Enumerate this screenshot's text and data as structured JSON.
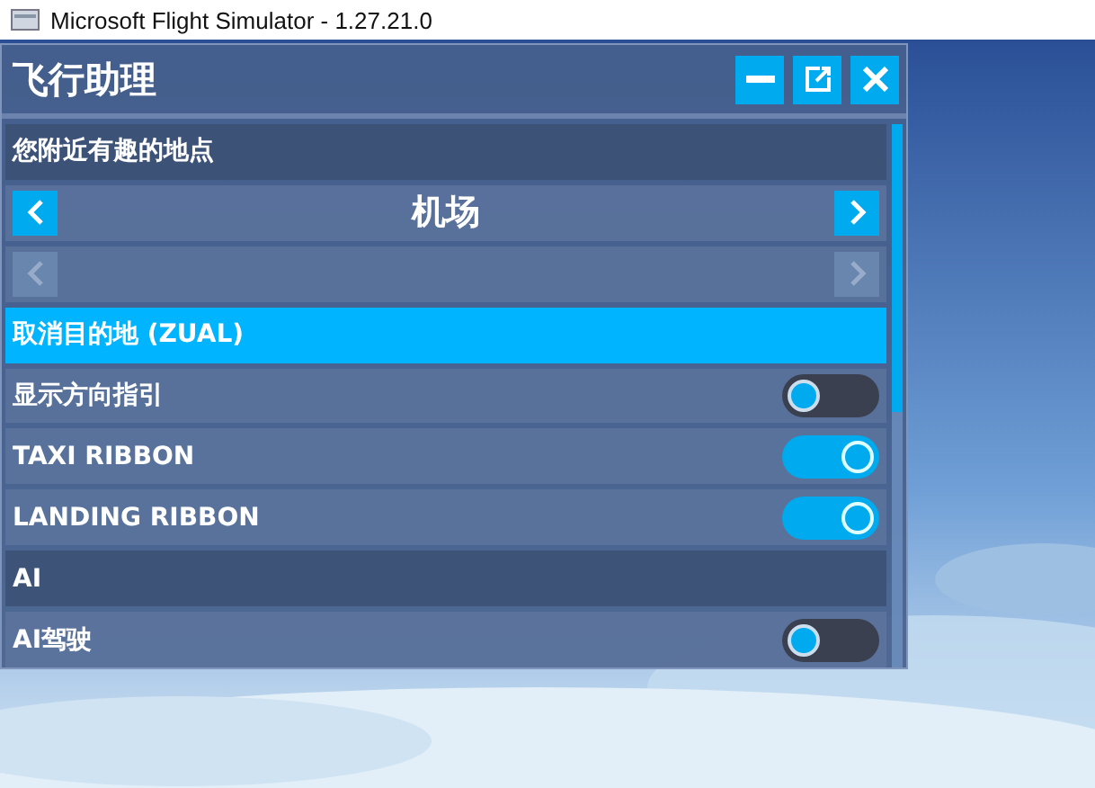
{
  "window": {
    "title": "Microsoft Flight Simulator - 1.27.21.0"
  },
  "panel": {
    "title": "飞行助理",
    "buttons": [
      {
        "kind": "minimize"
      },
      {
        "kind": "popout"
      },
      {
        "kind": "close"
      }
    ],
    "rows": [
      {
        "kind": "header",
        "label": "您附近有趣的地点"
      },
      {
        "kind": "selector",
        "label": "机场",
        "disabled": false
      },
      {
        "kind": "selector",
        "disabled": true
      },
      {
        "kind": "action",
        "label": "取消目的地 (ZUAL)",
        "selected": true
      },
      {
        "kind": "toggle",
        "label": "显示方向指引",
        "on": false
      },
      {
        "kind": "toggle",
        "label": "TAXI RIBBON",
        "on": true
      },
      {
        "kind": "toggle",
        "label": "LANDING RIBBON",
        "on": true
      },
      {
        "kind": "header",
        "label": "AI"
      },
      {
        "kind": "toggle",
        "label": "AI驾驶",
        "on": false
      }
    ]
  }
}
